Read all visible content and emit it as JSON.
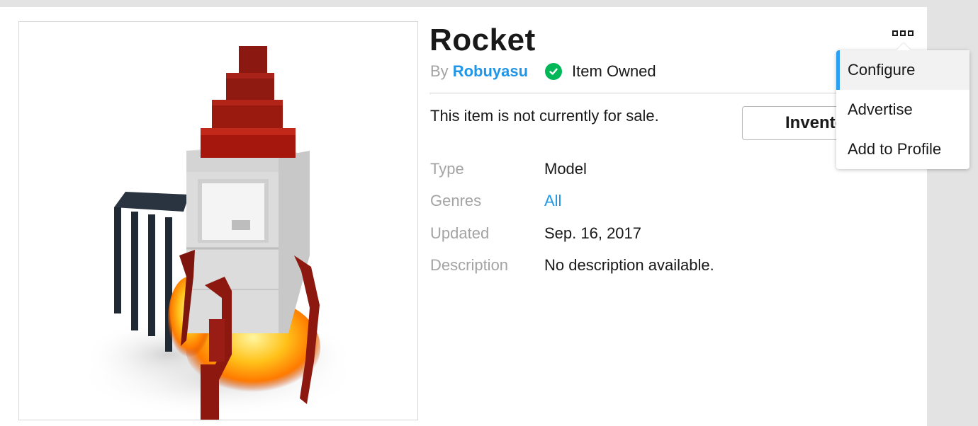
{
  "item": {
    "title": "Rocket",
    "by_label": "By",
    "creator": "Robuyasu",
    "owned_label": "Item Owned",
    "sale_status": "This item is not currently for sale.",
    "inventory_button": "Inventory"
  },
  "details": [
    {
      "label": "Type",
      "value": "Model"
    },
    {
      "label": "Genres",
      "value": "All"
    },
    {
      "label": "Updated",
      "value": "Sep. 16, 2017"
    },
    {
      "label": "Description",
      "value": "No description available."
    }
  ],
  "menu": {
    "items": [
      {
        "label": "Configure"
      },
      {
        "label": "Advertise"
      },
      {
        "label": "Add to Profile"
      }
    ]
  },
  "colors": {
    "link": "#2096e8",
    "owned_green": "#02b757",
    "menu_active_accent": "#2b9ff2",
    "label_gray": "#a3a3a3"
  },
  "icons": {
    "more": "more-options-icon",
    "owned": "checkmark-icon"
  }
}
